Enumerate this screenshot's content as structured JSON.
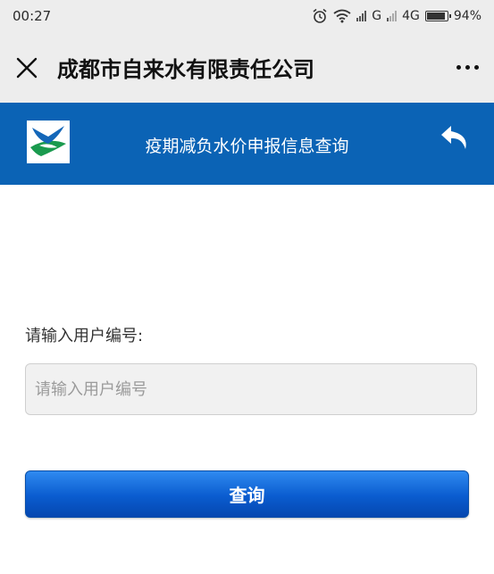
{
  "status_bar": {
    "time": "00:27",
    "carrier": "G",
    "network": "4G",
    "battery": "94%",
    "battery_level": 0.94,
    "icons": [
      "alarm-icon",
      "wifi-icon",
      "signal-icon",
      "battery-icon"
    ]
  },
  "title_bar": {
    "title": "成都市自来水有限责任公司",
    "close_icon": "close-icon",
    "more_icon": "more-icon"
  },
  "banner": {
    "title": "疫期减负水价申报信息查询",
    "background": "#0b63b5",
    "back_icon": "back-arrow-icon",
    "logo_icon": "company-logo"
  },
  "form": {
    "label": "请输入用户编号:",
    "input": {
      "value": "",
      "placeholder": "请输入用户编号"
    },
    "submit_label": "查询",
    "button_color": "#0a5ccf"
  }
}
